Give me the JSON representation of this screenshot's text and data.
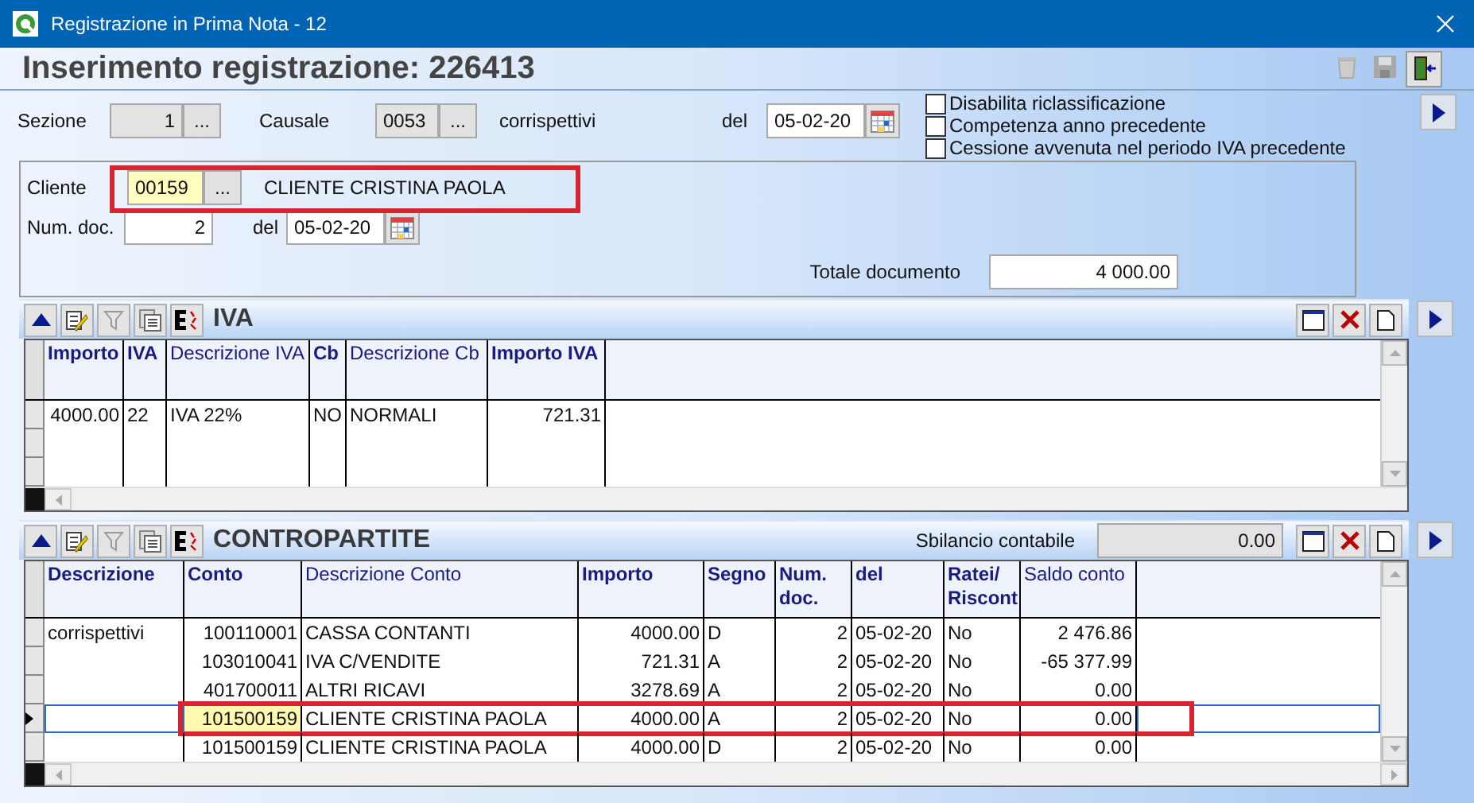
{
  "window": {
    "title": "Registrazione in Prima Nota - 12"
  },
  "heading": "Inserimento registrazione: 226413",
  "sezione": {
    "label": "Sezione",
    "value": "1",
    "button": "..."
  },
  "causale": {
    "label": "Causale",
    "value": "0053",
    "button": "...",
    "description": "corrispettivi"
  },
  "date": {
    "label": "del",
    "value": "05-02-20"
  },
  "options": [
    {
      "label": "Disabilita riclassificazione",
      "checked": false
    },
    {
      "label": "Competenza anno precedente",
      "checked": false
    },
    {
      "label": "Cessione avvenuta nel periodo IVA precedente",
      "checked": false
    }
  ],
  "cliente": {
    "label": "Cliente",
    "code": "00159",
    "button": "...",
    "name": "CLIENTE CRISTINA PAOLA",
    "highlighted": true
  },
  "document": {
    "num_label": "Num. doc.",
    "num": "2",
    "date_label": "del",
    "date": "05-02-20",
    "total_label": "Totale documento",
    "total": "4 000.00"
  },
  "iva": {
    "title": "IVA",
    "columns": [
      {
        "label": "Importo",
        "bold": true
      },
      {
        "label": "IVA",
        "bold": true
      },
      {
        "label": "Descrizione IVA",
        "bold": false
      },
      {
        "label": "Cb",
        "bold": true
      },
      {
        "label": "Descrizione Cb",
        "bold": false
      },
      {
        "label": "Importo IVA",
        "bold": true
      }
    ],
    "rows": [
      {
        "cells": [
          "4000.00",
          "22",
          "IVA 22%",
          "NO",
          "NORMALI",
          "721.31"
        ],
        "selected": false
      }
    ]
  },
  "contropartite": {
    "title": "CONTROPARTITE",
    "imbalance_label": "Sbilancio contabile",
    "imbalance": "0.00",
    "columns": [
      {
        "label": "Descrizione",
        "bold": true
      },
      {
        "label": "Conto",
        "bold": true
      },
      {
        "label": "Descrizione Conto",
        "bold": false
      },
      {
        "label": "Importo",
        "bold": true
      },
      {
        "label": "Segno",
        "bold": true
      },
      {
        "label": "Num. doc.",
        "bold": true
      },
      {
        "label": "del",
        "bold": true
      },
      {
        "label": "Ratei/ Riscont",
        "bold": true
      },
      {
        "label": "Saldo conto",
        "bold": false
      }
    ],
    "rows": [
      {
        "cells": [
          "corrispettivi",
          "100110001",
          "CASSA CONTANTI",
          "4000.00",
          "D",
          "2",
          "05-02-20",
          "No",
          "2 476.86"
        ],
        "selected": false
      },
      {
        "cells": [
          "",
          "103010041",
          "IVA C/VENDITE",
          "721.31",
          "A",
          "2",
          "05-02-20",
          "No",
          "-65 377.99"
        ],
        "selected": false
      },
      {
        "cells": [
          "",
          "401700011",
          "ALTRI RICAVI",
          "3278.69",
          "A",
          "2",
          "05-02-20",
          "No",
          "0.00"
        ],
        "selected": false
      },
      {
        "cells": [
          "",
          "101500159",
          "CLIENTE CRISTINA PAOLA",
          "4000.00",
          "A",
          "2",
          "05-02-20",
          "No",
          "0.00"
        ],
        "selected": true,
        "highlighted": true
      },
      {
        "cells": [
          "",
          "101500159",
          "CLIENTE CRISTINA PAOLA",
          "4000.00",
          "D",
          "2",
          "05-02-20",
          "No",
          "0.00"
        ],
        "selected": false
      }
    ]
  }
}
